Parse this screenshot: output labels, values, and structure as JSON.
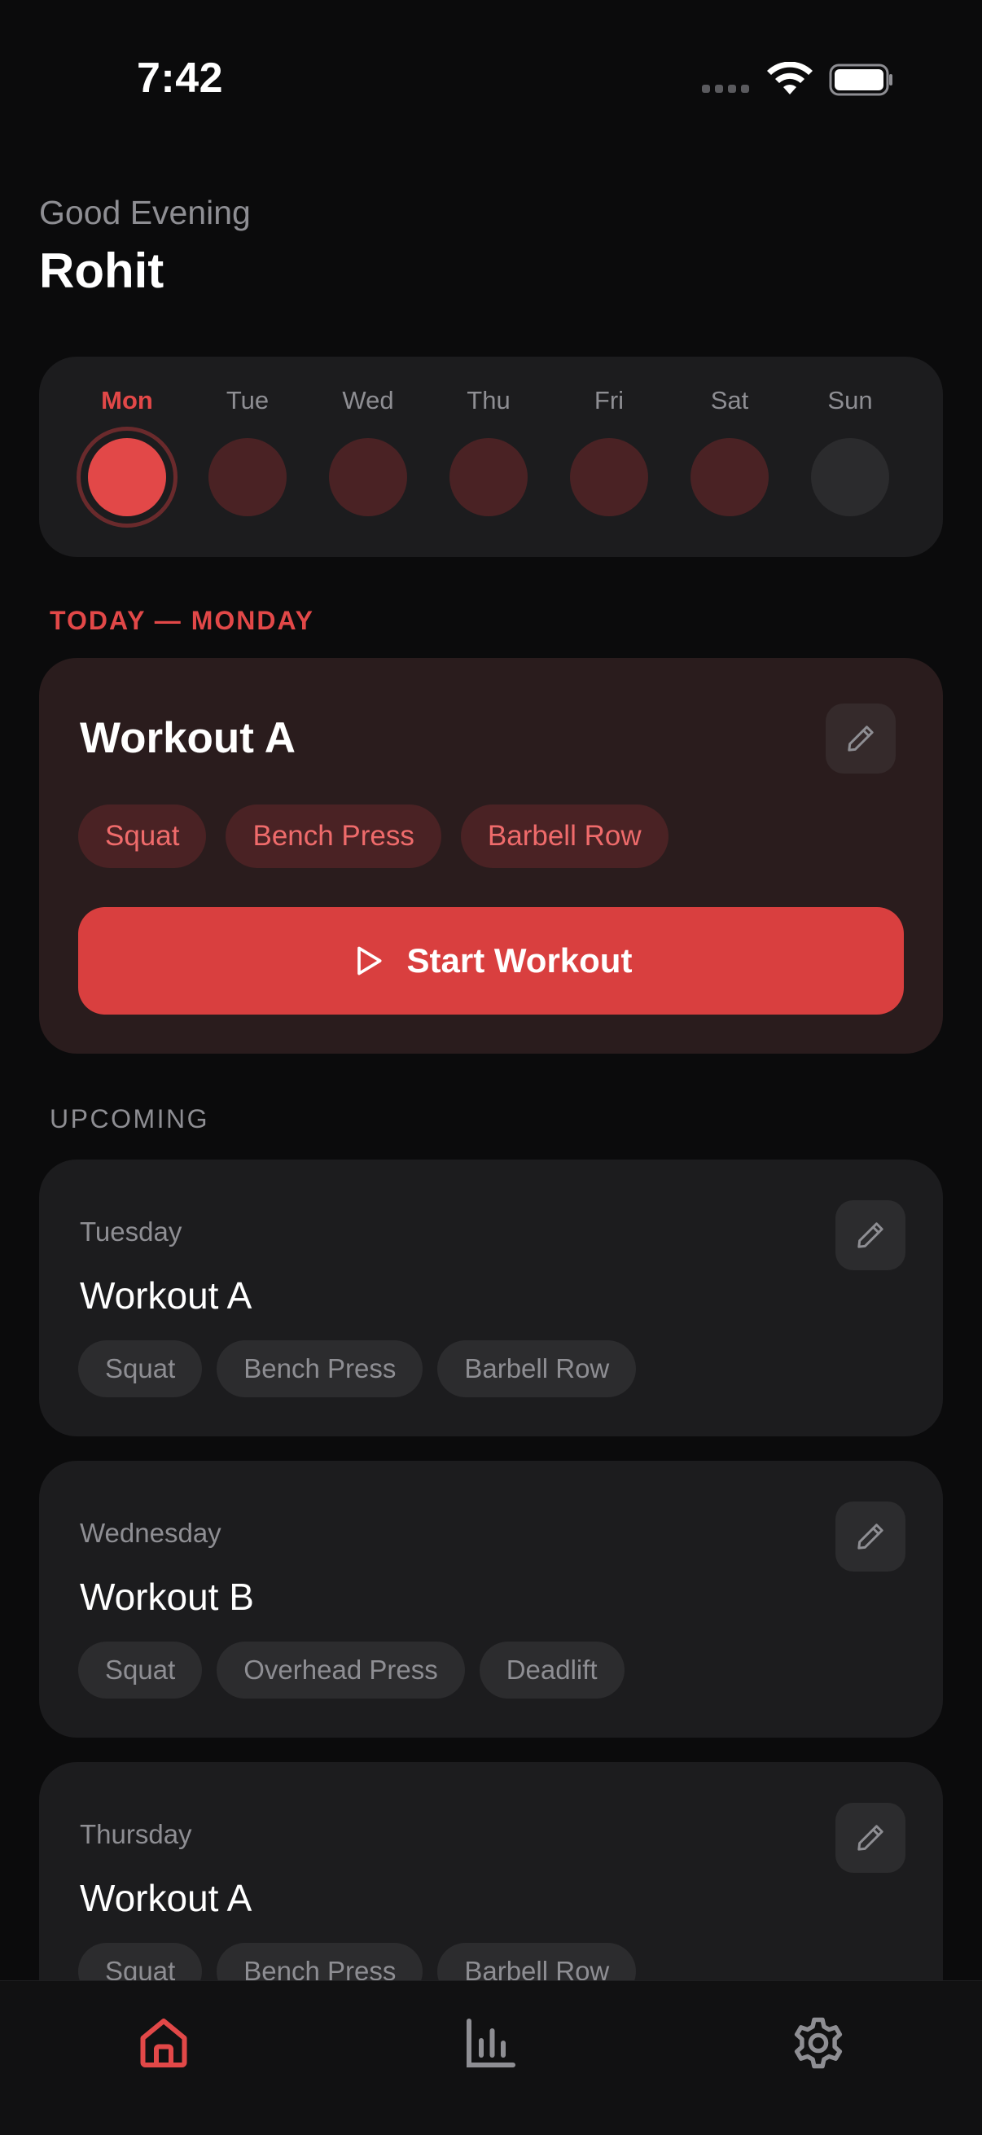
{
  "status_bar": {
    "time": "7:42"
  },
  "header": {
    "greeting": "Good Evening",
    "name": "Rohit"
  },
  "week": {
    "days": [
      {
        "label": "Mon",
        "state": "today"
      },
      {
        "label": "Tue",
        "state": "scheduled"
      },
      {
        "label": "Wed",
        "state": "scheduled"
      },
      {
        "label": "Thu",
        "state": "scheduled"
      },
      {
        "label": "Fri",
        "state": "scheduled"
      },
      {
        "label": "Sat",
        "state": "scheduled"
      },
      {
        "label": "Sun",
        "state": "rest"
      }
    ]
  },
  "today": {
    "section_label": "TODAY — MONDAY",
    "title": "Workout A",
    "exercises": [
      "Squat",
      "Bench Press",
      "Barbell Row"
    ],
    "start_label": "Start Workout"
  },
  "upcoming": {
    "section_label": "UPCOMING",
    "items": [
      {
        "day": "Tuesday",
        "title": "Workout A",
        "exercises": [
          "Squat",
          "Bench Press",
          "Barbell Row"
        ]
      },
      {
        "day": "Wednesday",
        "title": "Workout B",
        "exercises": [
          "Squat",
          "Overhead Press",
          "Deadlift"
        ]
      },
      {
        "day": "Thursday",
        "title": "Workout A",
        "exercises": [
          "Squat",
          "Bench Press",
          "Barbell Row"
        ]
      }
    ]
  },
  "tab_bar": {
    "tabs": [
      {
        "icon": "home-icon",
        "active": true
      },
      {
        "icon": "stats-icon",
        "active": false
      },
      {
        "icon": "settings-icon",
        "active": false
      }
    ]
  },
  "colors": {
    "accent": "#e24848",
    "background": "#0b0b0c",
    "card": "#1c1c1e",
    "today_card": "#2a1c1d",
    "muted_text": "#8e8e93"
  }
}
